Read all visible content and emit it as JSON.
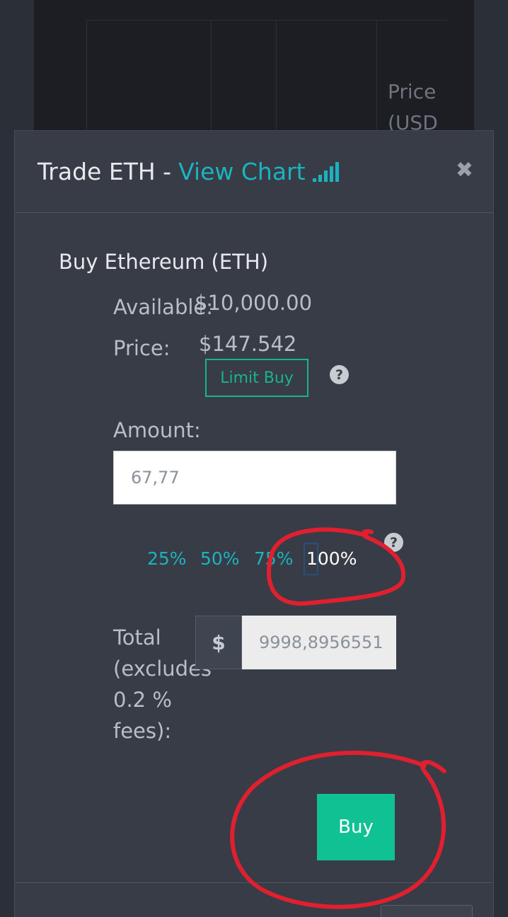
{
  "background": {
    "price_column_label": "Price (USD"
  },
  "modal": {
    "title_prefix": "Trade ETH -",
    "view_chart_label": "View Chart",
    "close_glyph": "✖",
    "section_title": "Buy Ethereum (ETH)",
    "available_label": "Available:",
    "available_value": "$10,000.00",
    "price_label": "Price:",
    "price_value": "$147.542",
    "limit_buy_label": "Limit Buy",
    "help_glyph": "?",
    "amount_label": "Amount:",
    "amount_value": "67,77",
    "percent_options": [
      "25%",
      "50%",
      "75%",
      "100%"
    ],
    "selected_percent": "100%",
    "total_label": "Total (excludes 0.2 % fees):",
    "currency_symbol": "$",
    "total_value": "9998,8956551",
    "buy_label": "Buy"
  },
  "colors": {
    "accent_teal": "#1bb3bd",
    "buy_green": "#10c193",
    "limit_border": "#17b48e",
    "annotation_red": "#e0202e"
  }
}
